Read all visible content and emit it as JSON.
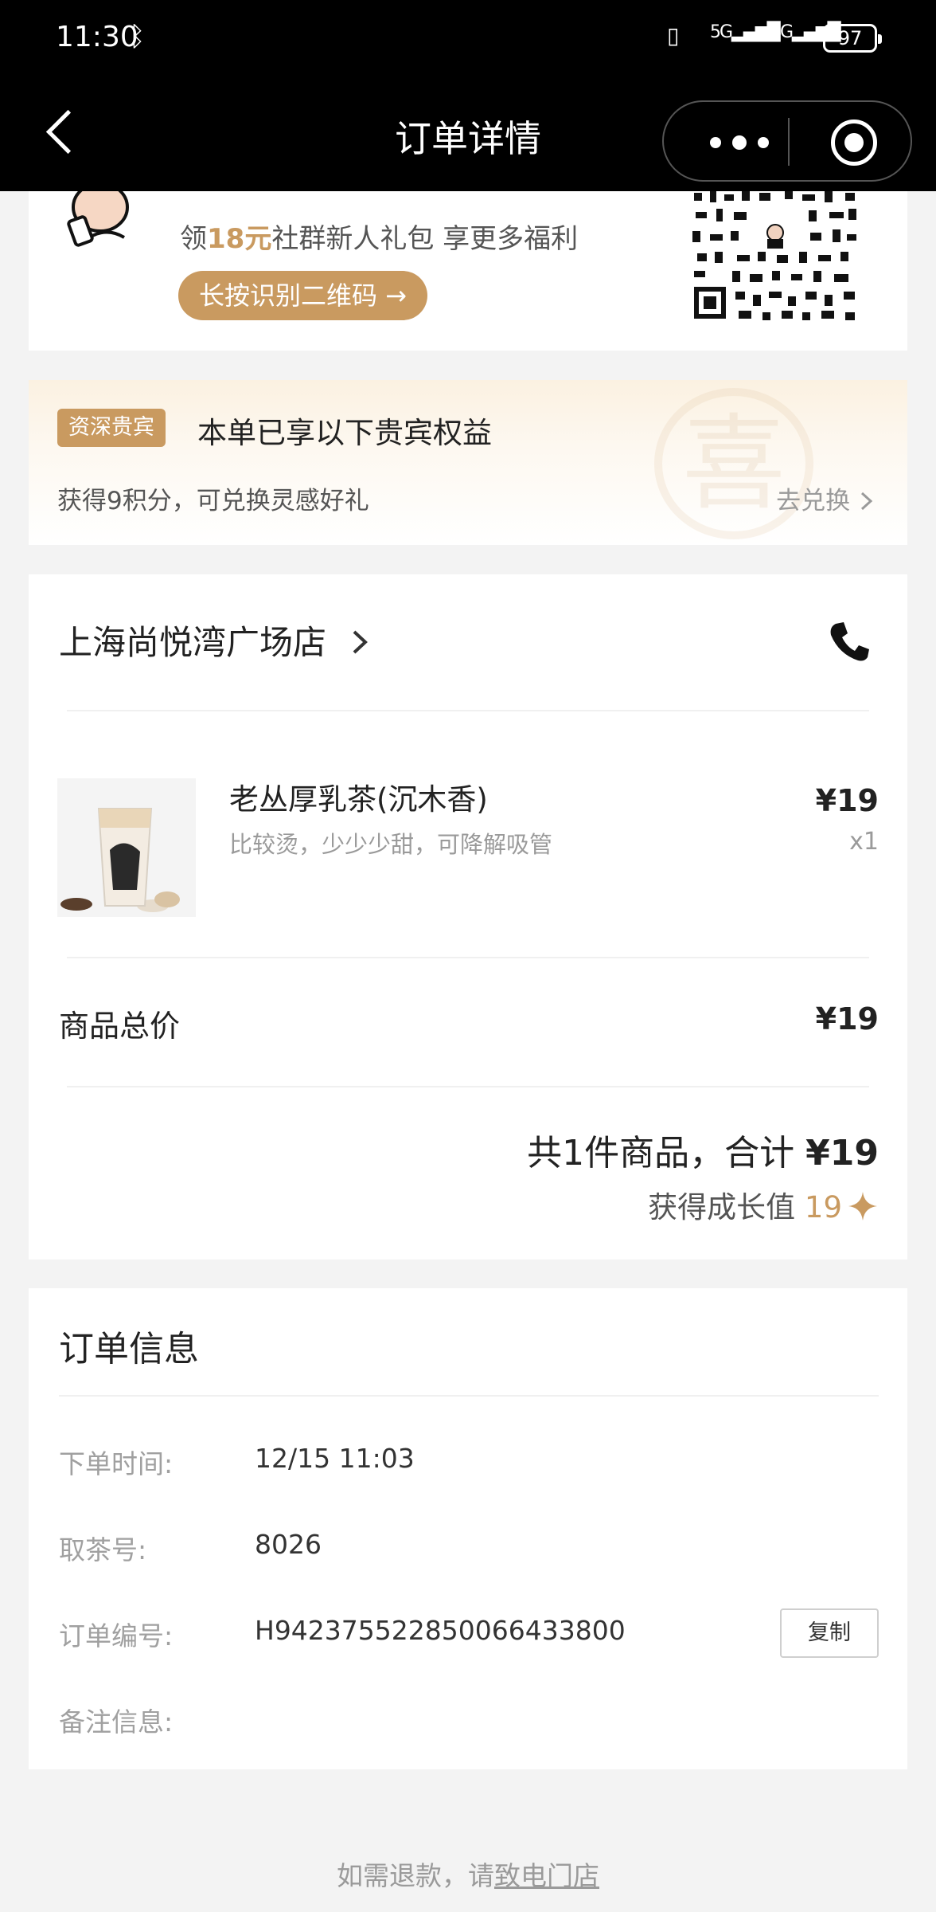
{
  "status_bar": {
    "time": "11:30",
    "network_5g": "5G",
    "network_4g": "4G",
    "battery": "97"
  },
  "nav": {
    "title": "订单详情"
  },
  "promo": {
    "line_prefix": "领",
    "line_amount": "18元",
    "line_suffix": "社群新人礼包 享更多福利",
    "button": "长按识别二维码 →"
  },
  "vip": {
    "badge": "资深贵宾",
    "headline": "本单已享以下贵宾权益",
    "points_text": "获得9积分，可兑换灵感好礼",
    "redeem": "去兑换",
    "watermark": "喜"
  },
  "order": {
    "store": "上海尚悦湾广场店",
    "item": {
      "name": "老丛厚乳茶(沉木香)",
      "options": "比较烫，少少少甜，可降解吸管",
      "price": "¥19",
      "qty": "x1"
    },
    "subtotal_label": "商品总价",
    "subtotal_value": "¥19",
    "total_text": "共1件商品，合计",
    "total_value": "¥19",
    "growth_label": "获得成长值",
    "growth_value": "19"
  },
  "info": {
    "heading": "订单信息",
    "rows": [
      {
        "label": "下单时间:",
        "value": "12/15 11:03"
      },
      {
        "label": "取茶号:",
        "value": "8026"
      },
      {
        "label": "订单编号:",
        "value": "H942375522850066433800"
      },
      {
        "label": "备注信息:",
        "value": ""
      }
    ],
    "copy_label": "复制"
  },
  "footer": {
    "prefix": "如需退款，请",
    "link": "致电门店"
  },
  "colors": {
    "accent": "#c99a60",
    "nav_bg": "#000000",
    "page_bg": "#f3f3f3"
  }
}
